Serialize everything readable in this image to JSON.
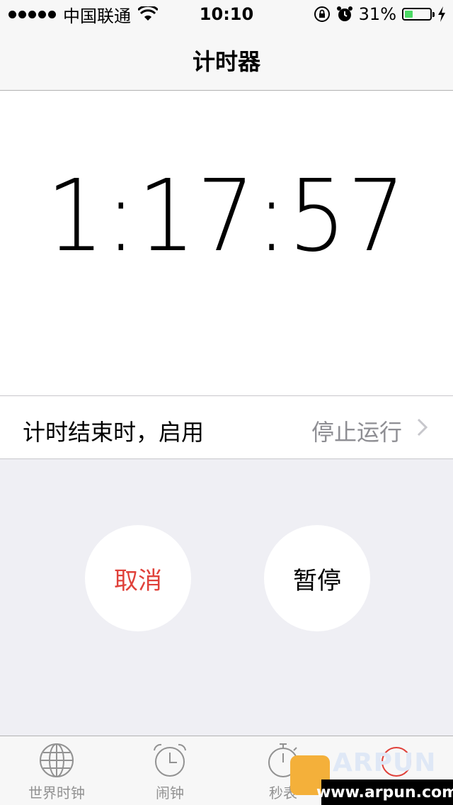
{
  "status_bar": {
    "carrier": "中国联通",
    "time": "10:10",
    "battery_percent_text": "31%",
    "battery_level": 0.31,
    "battery_color": "#4cd964"
  },
  "nav": {
    "title": "计时器"
  },
  "timer": {
    "display": "1:17:57"
  },
  "setting": {
    "label": "计时结束时，启用",
    "value": "停止运行"
  },
  "controls": {
    "cancel_label": "取消",
    "pause_label": "暂停",
    "cancel_color": "#e0413a"
  },
  "tabs": [
    {
      "label": "世界时钟",
      "icon": "globe-icon"
    },
    {
      "label": "闹钟",
      "icon": "alarm-clock-icon"
    },
    {
      "label": "秒表",
      "icon": "stopwatch-icon"
    },
    {
      "label": "",
      "icon": "timer-icon"
    }
  ],
  "watermark": {
    "brand": "ARPUN",
    "url": "www.arpun.com"
  }
}
